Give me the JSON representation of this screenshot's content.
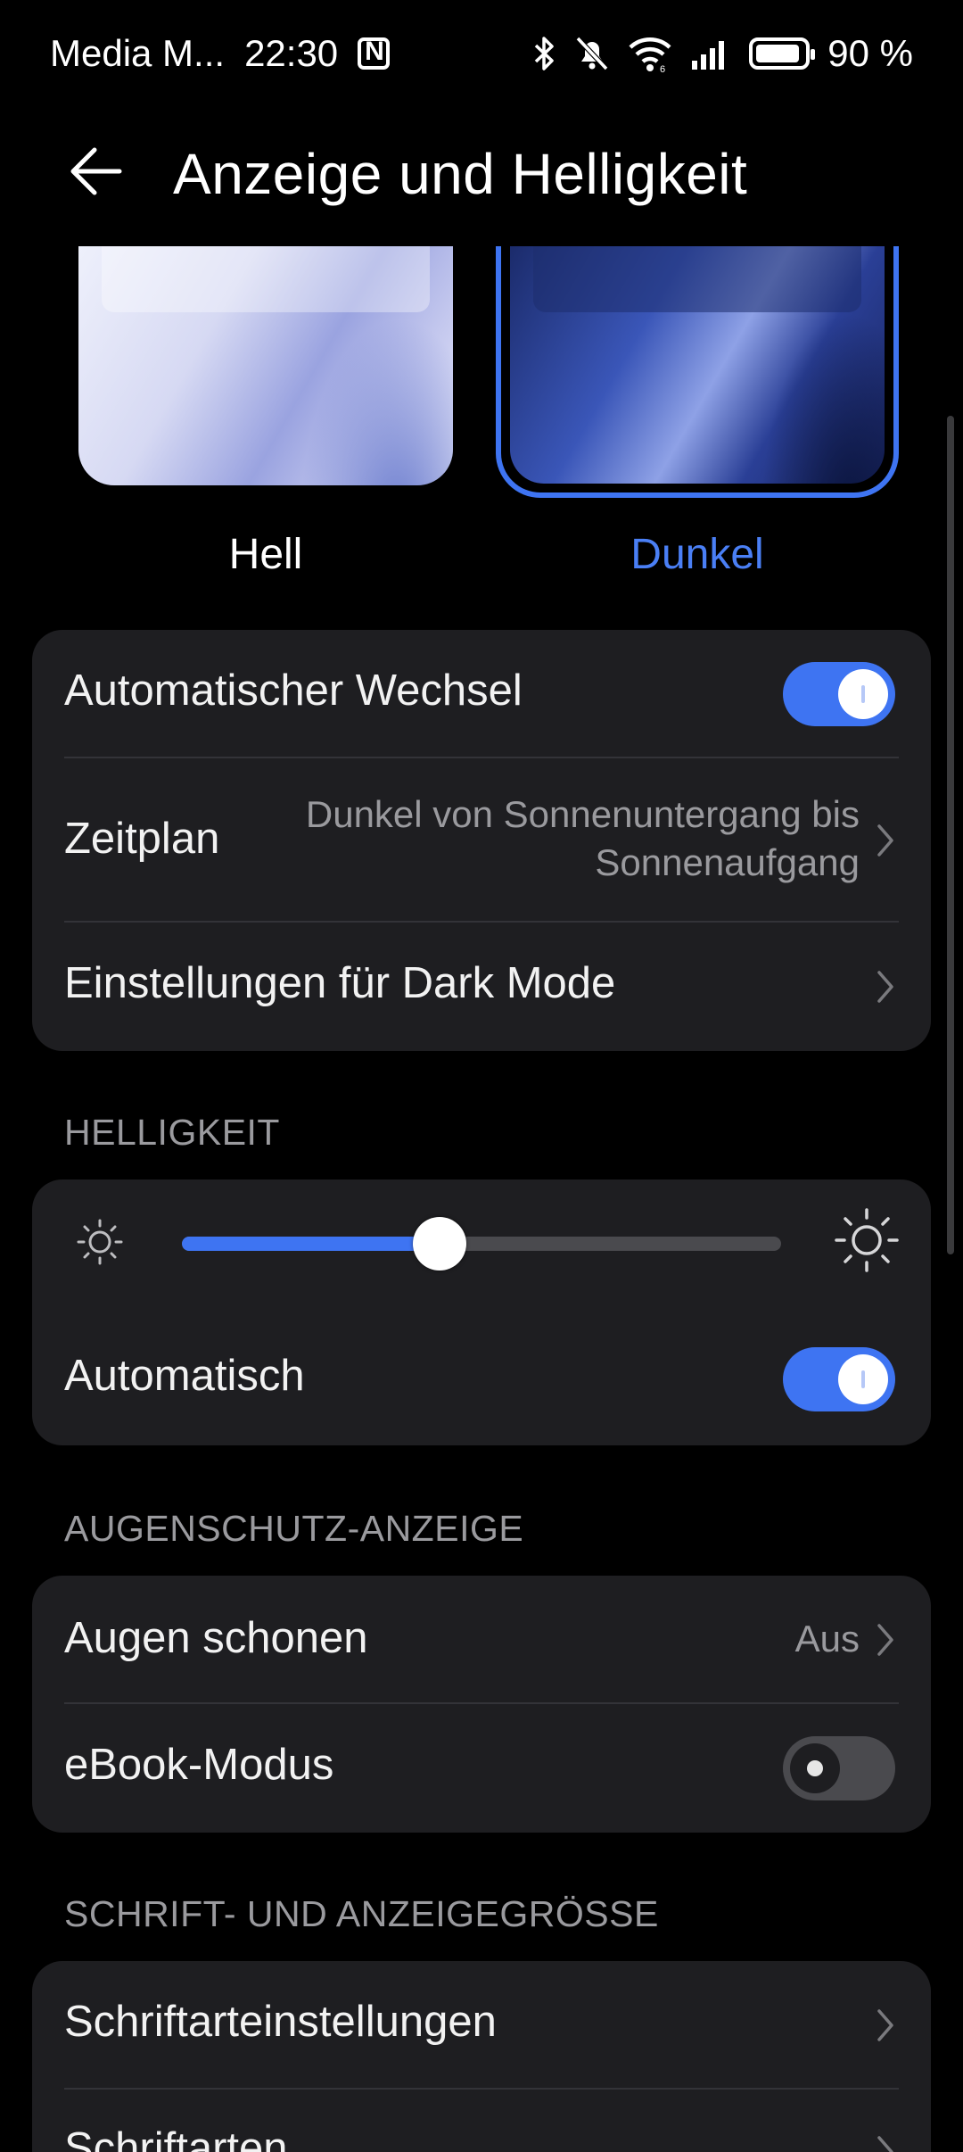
{
  "status_bar": {
    "carrier": "Media M...",
    "time": "22:30",
    "battery_percent": "90 %",
    "battery_level": 0.9,
    "icons": [
      "nfc-icon",
      "bluetooth-icon",
      "bell-muted-icon",
      "wifi-icon",
      "signal-icon",
      "battery-icon"
    ]
  },
  "header": {
    "title": "Anzeige und Helligkeit",
    "back_icon": "arrow-left-icon"
  },
  "theme": {
    "light_label": "Hell",
    "dark_label": "Dunkel",
    "selected": "Dunkel",
    "accent_color": "#3e74f2"
  },
  "dark_mode_card": {
    "auto_switch_label": "Automatischer Wechsel",
    "auto_switch_on": true,
    "schedule_label": "Zeitplan",
    "schedule_value_line1": "Dunkel von Sonnenuntergang bis",
    "schedule_value_line2": "Sonnenaufgang",
    "dark_mode_settings_label": "Einstellungen für Dark Mode"
  },
  "brightness": {
    "section_title": "HELLIGKEIT",
    "level": 0.43,
    "auto_label": "Automatisch",
    "auto_on": true
  },
  "eye_comfort": {
    "section_title": "AUGENSCHUTZ-ANZEIGE",
    "eye_comfort_label": "Augen schonen",
    "eye_comfort_value": "Aus",
    "ebook_label": "eBook-Modus",
    "ebook_on": false
  },
  "font_display": {
    "section_title": "SCHRIFT- UND ANZEIGEGRÖSSE",
    "font_settings_label": "Schriftarteinstellungen",
    "fonts_label": "Schriftarten"
  }
}
